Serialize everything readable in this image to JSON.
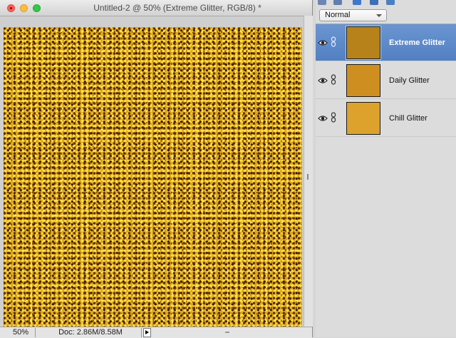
{
  "document": {
    "title": "Untitled-2 @ 50% (Extreme Glitter, RGB/8) *",
    "zoom": "50%",
    "doc_size": "Doc: 2.86M/8.58M"
  },
  "layers_panel": {
    "blend_mode": "Normal",
    "layers": [
      {
        "name": "Extreme Glitter",
        "selected": true,
        "visible": true,
        "thumb_color": "#b8821a"
      },
      {
        "name": "Daily Glitter",
        "selected": false,
        "visible": true,
        "thumb_color": "#cf8f20"
      },
      {
        "name": "Chill Glitter",
        "selected": false,
        "visible": true,
        "thumb_color": "#dca22c"
      }
    ]
  },
  "colors": {
    "selection": "#5a86c6",
    "glitter_base": "#dca71c"
  },
  "icons": [
    "close-icon",
    "minimize-icon",
    "zoom-icon",
    "eye-icon",
    "link-icon",
    "chevron-down-icon",
    "triangle-right-icon"
  ]
}
